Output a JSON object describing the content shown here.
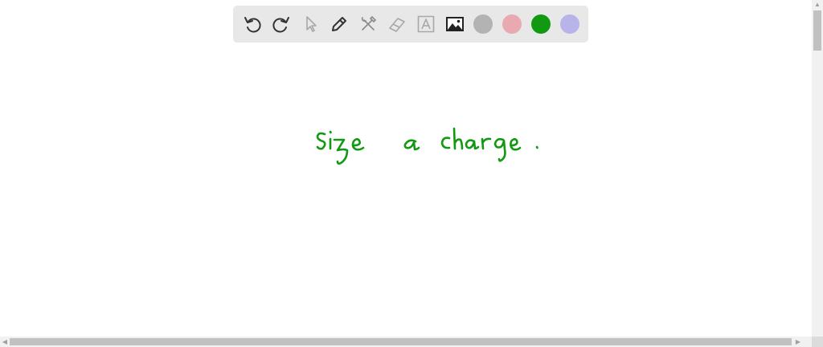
{
  "toolbar": {
    "tools": [
      {
        "name": "undo-icon"
      },
      {
        "name": "redo-icon"
      },
      {
        "name": "pointer-icon"
      },
      {
        "name": "pen-icon"
      },
      {
        "name": "tools-icon"
      },
      {
        "name": "eraser-icon"
      },
      {
        "name": "text-box-icon"
      },
      {
        "name": "image-icon"
      }
    ],
    "colors": [
      "#b3b3b3",
      "#e8a9b0",
      "#119911",
      "#b8b3e8"
    ]
  },
  "canvas": {
    "handwritten_text": "size a charge.",
    "ink_color": "#119911"
  }
}
